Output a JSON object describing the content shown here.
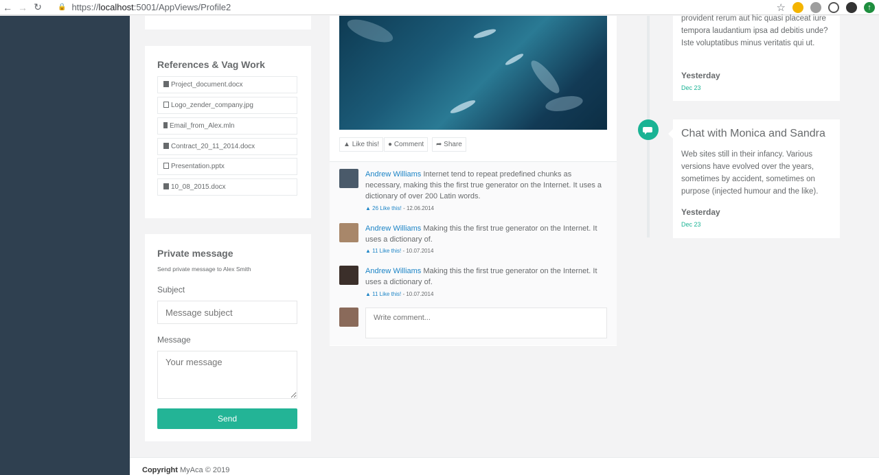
{
  "browser": {
    "url_prefix": "https://",
    "url_host": "localhost",
    "url_rest": ":5001/AppViews/Profile2"
  },
  "references": {
    "title": "References & Vag Work",
    "files": [
      {
        "name": "Project_document.docx",
        "icon": "file-icon"
      },
      {
        "name": "Logo_zender_company.jpg",
        "icon": "image-file-icon"
      },
      {
        "name": "Email_from_Alex.mln",
        "icon": "list-icon"
      },
      {
        "name": "Contract_20_11_2014.docx",
        "icon": "file-icon"
      },
      {
        "name": "Presentation.pptx",
        "icon": "powerpoint-file-icon"
      },
      {
        "name": "10_08_2015.docx",
        "icon": "file-icon"
      }
    ]
  },
  "private_message": {
    "title": "Private message",
    "subtitle": "Send private message to Alex Smith",
    "subject_label": "Subject",
    "subject_placeholder": "Message subject",
    "message_label": "Message",
    "message_placeholder": "Your message",
    "send_label": "Send"
  },
  "post": {
    "actions": {
      "like": "Like this!",
      "comment": "Comment",
      "share": "Share"
    },
    "comments": [
      {
        "author": "Andrew Williams",
        "text": "Internet tend to repeat predefined chunks as necessary, making this the first true generator on the Internet. It uses a dictionary of over 200 Latin words.",
        "likes": "26 Like this!",
        "date": "12.06.2014"
      },
      {
        "author": "Andrew Williams",
        "text": "Making this the first true generator on the Internet. It uses a dictionary of.",
        "likes": "11 Like this!",
        "date": "10.07.2014"
      },
      {
        "author": "Andrew Williams",
        "text": "Making this the first true generator on the Internet. It uses a dictionary of.",
        "likes": "11 Like this!",
        "date": "10.07.2014"
      }
    ],
    "write_placeholder": "Write comment..."
  },
  "timeline": {
    "items": [
      {
        "body": "provident rerum aut hic quasi placeat iure tempora laudantium ipsa ad debitis unde? Iste voluptatibus minus veritatis qui ut.",
        "when": "Yesterday",
        "date": "Dec 23"
      },
      {
        "title": "Chat with Monica and Sandra",
        "body": "Web sites still in their infancy. Various versions have evolved over the years, sometimes by accident, sometimes on purpose (injected humour and the like).",
        "when": "Yesterday",
        "date": "Dec 23",
        "icon": "comments-icon"
      }
    ]
  },
  "footer": {
    "copyright_label": "Copyright",
    "copyright_text": "MyAca © 2019"
  },
  "colors": {
    "sidebar": "#2f4050",
    "accent": "#1ab394",
    "link": "#1c84c6"
  }
}
